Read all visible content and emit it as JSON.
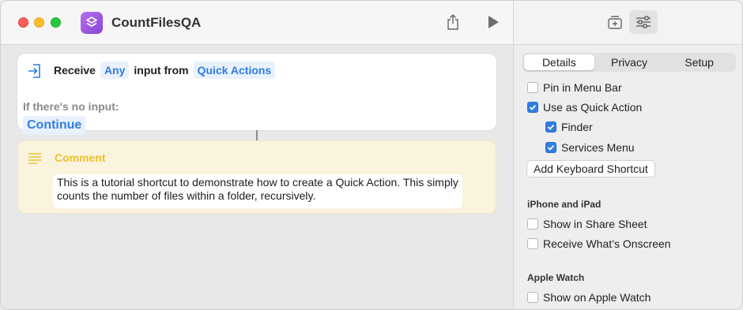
{
  "window": {
    "title": "CountFilesQA"
  },
  "icons": {
    "app": "shortcuts-icon",
    "share": "share-icon",
    "run": "play-icon",
    "add_to_dock": "add-to-dock-icon",
    "settings": "sliders-icon",
    "receive": "receive-input-icon",
    "comment": "comment-lines-icon"
  },
  "receive_action": {
    "label_receive": "Receive",
    "input_type": "Any",
    "label_input_from": "input from",
    "source": "Quick Actions",
    "no_input_label": "If there's no input:",
    "no_input_action": "Continue"
  },
  "comment_action": {
    "title": "Comment",
    "text": "This is a tutorial shortcut to demonstrate how to create a Quick Action. This simply counts the number of files within a folder, recursively."
  },
  "inspector": {
    "tabs": [
      "Details",
      "Privacy",
      "Setup"
    ],
    "active_tab": "Details",
    "options": {
      "pin_menu_bar": {
        "label": "Pin in Menu Bar",
        "checked": false
      },
      "quick_action": {
        "label": "Use as Quick Action",
        "checked": true
      },
      "finder": {
        "label": "Finder",
        "checked": true
      },
      "services_menu": {
        "label": "Services Menu",
        "checked": true
      }
    },
    "add_shortcut_button": "Add Keyboard Shortcut",
    "iphone_section": "iPhone and iPad",
    "share_sheet": {
      "label": "Show in Share Sheet",
      "checked": false
    },
    "onscreen": {
      "label": "Receive What’s Onscreen",
      "checked": false
    },
    "watch_section": "Apple Watch",
    "apple_watch": {
      "label": "Show on Apple Watch",
      "checked": false
    }
  },
  "colors": {
    "accent": "#2f7de1",
    "comment_title": "#e9c22e",
    "comment_bg": "#faf4de"
  }
}
